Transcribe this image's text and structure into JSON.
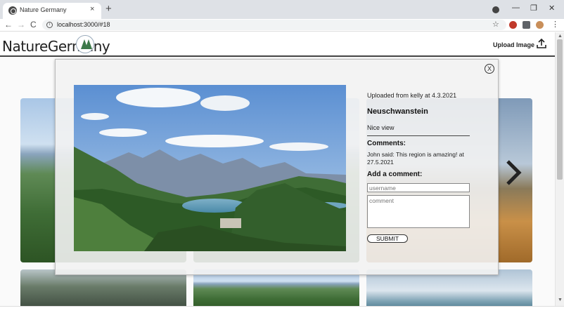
{
  "browser": {
    "tab_title": "Nature Germany",
    "tab_close": "×",
    "new_tab": "+",
    "back": "←",
    "forward": "→",
    "reload": "C",
    "info": "i",
    "url": "localhost:3000/#18",
    "bookmark": "☆",
    "menu": "⋮",
    "minimize": "—",
    "restore": "❐",
    "close": "✕"
  },
  "header": {
    "logo": "NatureGermany",
    "upload_label": "Upload Image"
  },
  "modal": {
    "close_label": "X",
    "uploaded_info": "Uploaded from kelly at 4.3.2021",
    "title": "Neuschwanstein",
    "description": "Nice view",
    "comments_heading": "Comments:",
    "comments": [
      {
        "text": "John said: This region is amazing! at 27.5.2021"
      }
    ],
    "add_comment_heading": "Add a comment:",
    "username_placeholder": "username",
    "comment_placeholder": "comment",
    "submit_label": "SUBMIT"
  },
  "scrollbar": {
    "up": "▲",
    "down": "▼"
  },
  "colors": {
    "tab_bar": "#dee1e6",
    "forest_green": "#3d7a4a",
    "overlay": "#f2f2f2"
  }
}
